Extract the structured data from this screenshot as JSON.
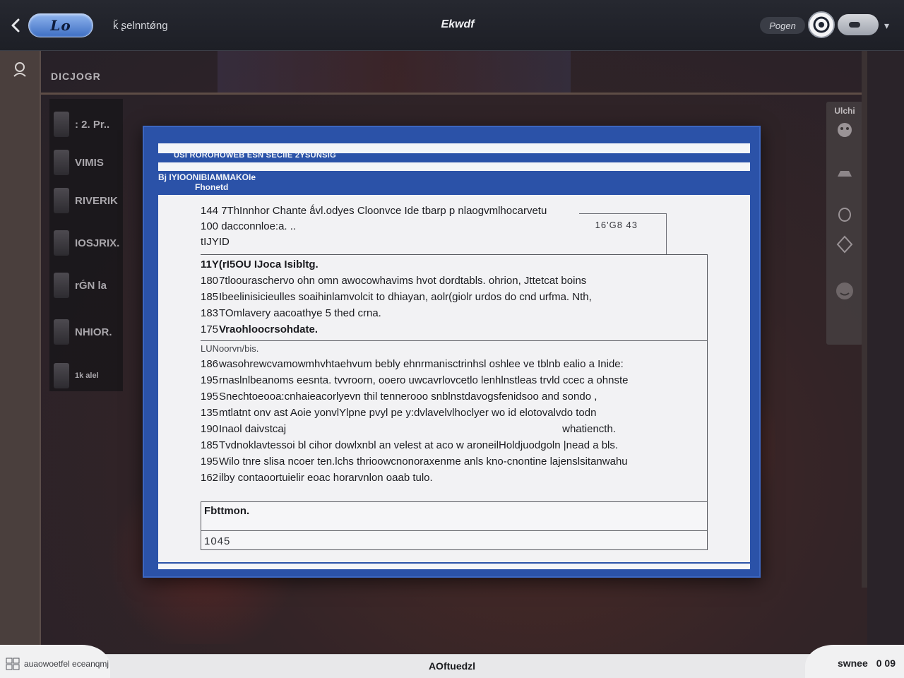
{
  "topbar": {
    "app_logo_text": "Lo",
    "app_name": "ǩ ʂelnntǿng",
    "window_title": "Ekwdf",
    "user_label": "Pogen",
    "icons": [
      "back-arrow-icon",
      "profile-icon",
      "status-toggle",
      "chevron-down-icon"
    ]
  },
  "main": {
    "breadcrumb": "DICJOGR",
    "list_items": [
      {
        "label": ": 2. Pr.."
      },
      {
        "label": "VIMIS"
      },
      {
        "label": "RIVERIK"
      },
      {
        "label": "IOSJRIX."
      },
      {
        "label": "rǴN  la"
      },
      {
        "label": "NHIOR."
      },
      {
        "label": "1k alel"
      }
    ],
    "right_column": {
      "caption": "Ulchi",
      "icons": [
        "face-icon",
        "hat-icon",
        "drop-icon",
        "badge-icon",
        "emoji-icon"
      ]
    }
  },
  "dialog": {
    "header_line": "USI ROROHOWEB ESN SECIIE 2YSUNSIG",
    "header_title": "Bj IYIOONIBIAMMAKOIe",
    "header_sub": "Fhonetd",
    "top_rows": [
      "144 7ThInnhor Chante ǻvl.odyes Cloonvce Ide  tbarp p nlaogvmlhocarvetu",
      "100 dacconnloe:a. ..",
      "tIJYID"
    ],
    "ref_number": "16'G8 43",
    "section1": {
      "title": "11Y(rI5OU IJoca Isibltg.",
      "rows": [
        {
          "num": "180",
          "text": "7tloouraschervo ohn omn awocowhavims hvot dordtabls. ohrion, Jttetcat boins"
        },
        {
          "num": "185",
          "text": "Ibeelinisicieulles soaihinlamvolcit  to dhiayan, aolr(giolr urdos do cnd urfma. Nth,"
        },
        {
          "num": "183",
          "text": "TOmlavery aacoathye 5 thed crna."
        },
        {
          "num": "175",
          "text": "Vraohloocrsohdate."
        }
      ]
    },
    "section2": {
      "title": "LUNoorvn/bis.",
      "rows": [
        {
          "num": "186",
          "text": "wasohrewcvamowmhvhtaehvum bebly ehnrmanisctrinhsl oshlee ve tblnb ealio a Inide:"
        },
        {
          "num": "195",
          "text": "rnaslnlbeanoms eesnta. tvvroorn, ooero  uwcavrlovcetlo lenhlnstleas trvld ccec a ohnste"
        },
        {
          "num": "195",
          "text": "Snechtoeooa:cnhaieacorlyevn thil  tennerooo snblnstdavogsfenidsoo and sondo ,"
        },
        {
          "num": "135",
          "text": "mtlatnt onv ast Aoie yonvlYlpne pvyl pe y:dvlavelvlhoclyer wo id elotovalvdo todn"
        },
        {
          "num": "190",
          "text": "Inaol daivstcaj",
          "text_right": "whatiencth."
        },
        {
          "num": "185",
          "text": "Tvdnoklavtessoi bl cihor dowlxnbl an velest at aco w aroneilHoldjuodgoln |nead a bls."
        },
        {
          "num": "195",
          "text": "Wilo tnre slisa ncoer ten.lchs  thrioowcnonoraxenme anls kno-cnontine lajenslsitanwahu"
        },
        {
          "num": "162",
          "text": "ilby contaoortuielir eoac horarvnlon oaab tulo."
        }
      ]
    },
    "field": {
      "label": "Fbttmon.",
      "value": "1045"
    }
  },
  "bottombar": {
    "left_text": "auaowoetfel eceanqmj",
    "center_text": "AOftuedzl",
    "right_text": "swnee",
    "right_count": "0 09"
  }
}
